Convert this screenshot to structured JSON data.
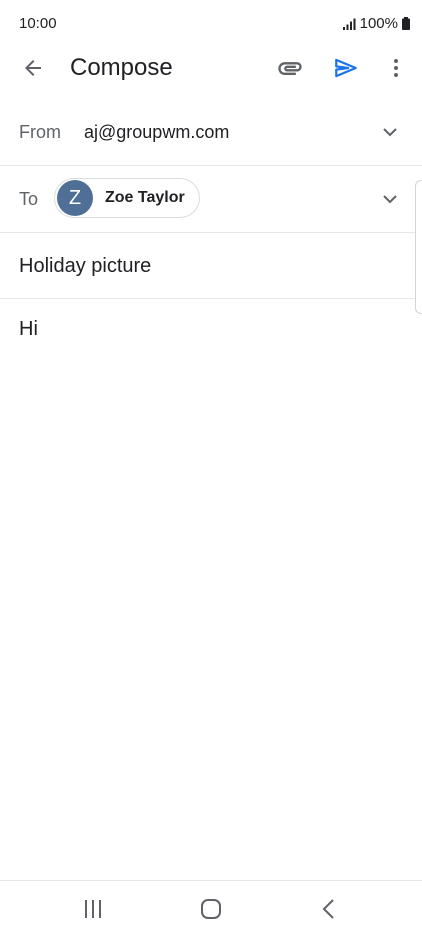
{
  "status_bar": {
    "time": "10:00",
    "battery_text": "100%",
    "icons": [
      "signal-icon",
      "battery-icon"
    ]
  },
  "toolbar": {
    "title": "Compose",
    "icons": [
      "back-arrow-icon",
      "paperclip-icon",
      "send-icon",
      "more-vert-icon"
    ],
    "send_color": "#1a73e8"
  },
  "from": {
    "label": "From",
    "value": "aj@groupwm.com"
  },
  "to": {
    "label": "To",
    "recipient": {
      "initial": "Z",
      "name": "Zoe Taylor",
      "avatar_color": "#4f6f96"
    }
  },
  "subject": {
    "value": "Holiday picture"
  },
  "body": {
    "value": "Hi"
  },
  "nav_bar": {
    "icons": [
      "recents-icon",
      "home-icon",
      "nav-back-icon"
    ]
  }
}
